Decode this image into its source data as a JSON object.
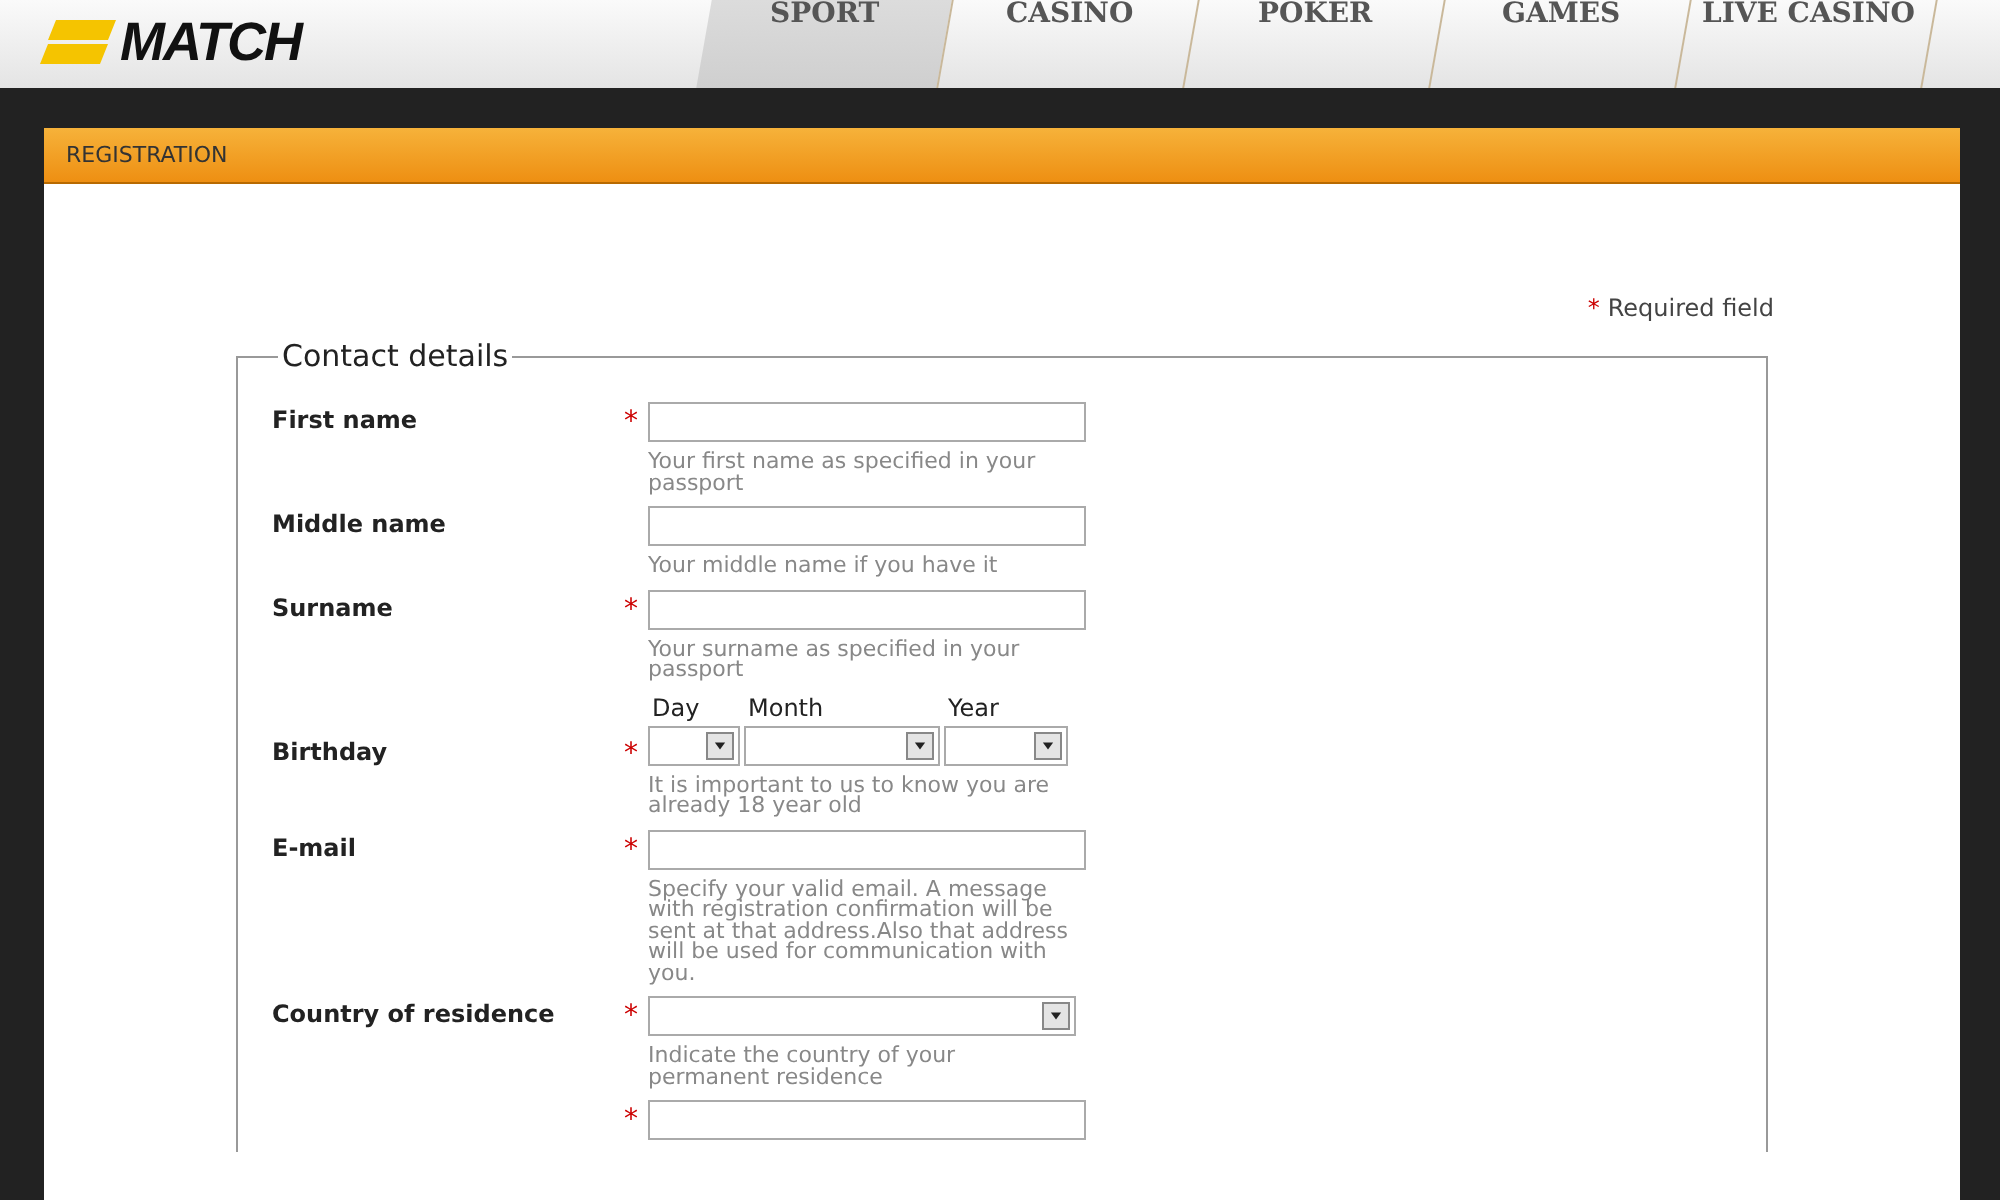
{
  "header": {
    "logo": "MATCH",
    "tabs": [
      {
        "label": "SPORT",
        "selected": true
      },
      {
        "label": "CASINO",
        "selected": false
      },
      {
        "label": "POKER",
        "selected": false
      },
      {
        "label": "GAMES",
        "selected": false
      },
      {
        "label": "LIVE CASINO",
        "selected": false
      }
    ]
  },
  "panel": {
    "title": "REGISTRATION",
    "required_note": "Required field",
    "required_mark": "*",
    "fieldset": {
      "legend": "Contact details",
      "fields": [
        {
          "kind": "text",
          "label": "First name",
          "required": true,
          "hint": "Your first name as specified in your passport"
        },
        {
          "kind": "text",
          "label": "Middle name",
          "required": false,
          "hint": "Your middle name if you have it"
        },
        {
          "kind": "text",
          "label": "Surname",
          "required": true,
          "hint": "Your surname as specified in your passport"
        },
        {
          "kind": "date",
          "label": "Birthday",
          "required": true,
          "parts": [
            "Day",
            "Month",
            "Year"
          ],
          "hint": "It is important to us to know you are already 18 year old"
        },
        {
          "kind": "text",
          "label": "E-mail",
          "required": true,
          "hint": "Specify your valid email. A message with registration confirmation will be sent at that address.Also that address will be used for communication with you."
        },
        {
          "kind": "select",
          "label": "Country of residence",
          "required": true,
          "hint": "Indicate the country of your permanent residence"
        },
        {
          "kind": "text",
          "required": true
        }
      ]
    }
  }
}
